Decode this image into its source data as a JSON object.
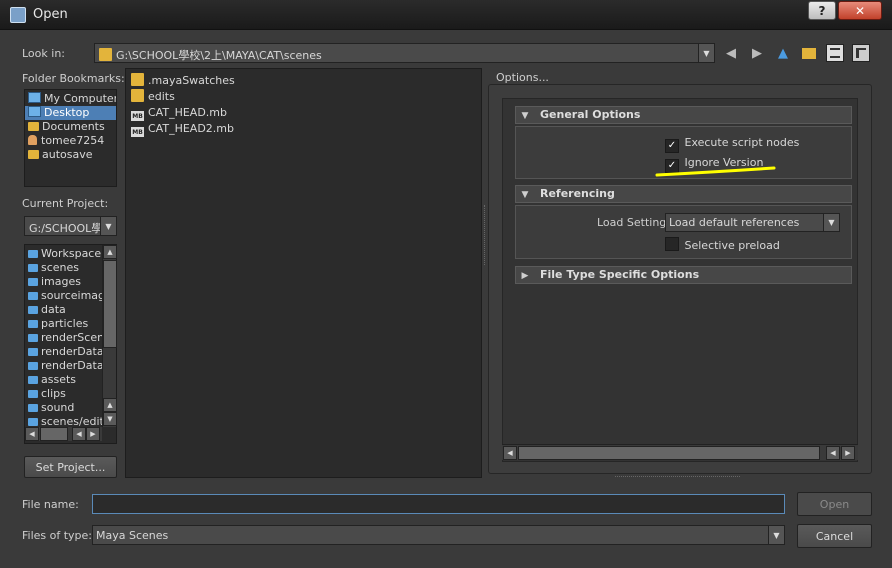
{
  "window": {
    "title": "Open",
    "help_label": "?",
    "close_label": "✕"
  },
  "look_in": {
    "label": "Look in:",
    "path": "G:\\SCHOOL學校\\2上\\MAYA\\CAT\\scenes"
  },
  "toolbar": {
    "icons": [
      "back-icon",
      "forward-icon",
      "up-icon",
      "new-folder-icon",
      "list-view-icon",
      "detail-view-icon"
    ]
  },
  "bookmarks": {
    "label": "Folder Bookmarks:",
    "items": [
      {
        "label": "My Computer",
        "icon": "computer-icon"
      },
      {
        "label": "Desktop",
        "icon": "desktop-icon",
        "selected": true
      },
      {
        "label": "Documents",
        "icon": "folder-icon"
      },
      {
        "label": "tomee7254",
        "icon": "user-icon"
      },
      {
        "label": "autosave",
        "icon": "folder-icon"
      }
    ]
  },
  "project": {
    "label": "Current Project:",
    "value": "G:/SCHOOL學",
    "folders": [
      "Workspace F",
      "scenes",
      "images",
      "sourceimage",
      "data",
      "particles",
      "renderScene",
      "renderData/",
      "renderData/",
      "assets",
      "clips",
      "sound",
      "scenes/edits"
    ],
    "set_button": "Set Project..."
  },
  "files": [
    {
      "name": ".mayaSwatches",
      "type": "folder"
    },
    {
      "name": "edits",
      "type": "folder"
    },
    {
      "name": "CAT_HEAD.mb",
      "type": "mb"
    },
    {
      "name": "CAT_HEAD2.mb",
      "type": "mb"
    }
  ],
  "options": {
    "title": "Options...",
    "general": {
      "header": "General Options",
      "execute_script_nodes": {
        "label": "Execute script nodes",
        "checked": true
      },
      "ignore_version": {
        "label": "Ignore Version",
        "checked": true
      }
    },
    "referencing": {
      "header": "Referencing",
      "load_settings_label": "Load Settings",
      "load_settings_value": "Load default references",
      "selective_preload": {
        "label": "Selective preload",
        "checked": false
      }
    },
    "file_type": {
      "header": "File Type Specific Options"
    }
  },
  "bottom": {
    "file_name_label": "File name:",
    "file_name_value": "",
    "files_of_type_label": "Files of type:",
    "files_of_type_value": "Maya Scenes",
    "open_button": "Open",
    "cancel_button": "Cancel"
  },
  "annotation_color": "#ffff00"
}
